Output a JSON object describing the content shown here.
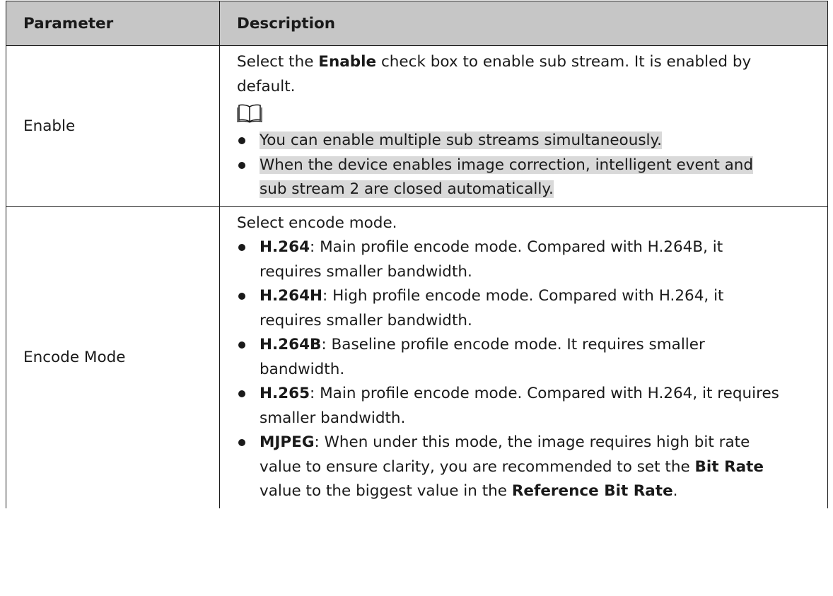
{
  "table": {
    "headers": {
      "parameter": "Parameter",
      "description": "Description"
    },
    "rows": [
      {
        "parameter": "Enable",
        "intro_pre": "Select the ",
        "intro_bold": "Enable",
        "intro_post_line1": " check box to enable sub stream. It is enabled by",
        "intro_line2": "default.",
        "note_icon": "book-note-icon",
        "notes": [
          {
            "text": "You can enable multiple sub streams simultaneously."
          },
          {
            "line1": "When the device enables image correction, intelligent event and",
            "line2": "sub stream 2 are closed automatically."
          }
        ]
      },
      {
        "parameter": "Encode Mode",
        "intro": "Select encode mode.",
        "items": [
          {
            "term": "H.264",
            "line1": ": Main profile encode mode. Compared with H.264B, it",
            "line2": "requires smaller bandwidth."
          },
          {
            "term": "H.264H",
            "line1": ": High profile encode mode. Compared with H.264, it",
            "line2": "requires smaller bandwidth."
          },
          {
            "term": "H.264B",
            "line1": ": Baseline profile encode mode. It requires smaller",
            "line2": "bandwidth."
          },
          {
            "term": "H.265",
            "line1": ": Main profile encode mode. Compared with H.264, it requires",
            "line2": "smaller bandwidth."
          },
          {
            "term": "MJPEG",
            "line1": ": When under this mode, the image requires high bit rate",
            "line2a": "value to ensure clarity, you are recommended to set the ",
            "line2_bold": "Bit Rate",
            "line3a": "value to the biggest value in the ",
            "line3_bold": "Reference Bit Rate",
            "line3_end": "."
          }
        ]
      }
    ]
  }
}
